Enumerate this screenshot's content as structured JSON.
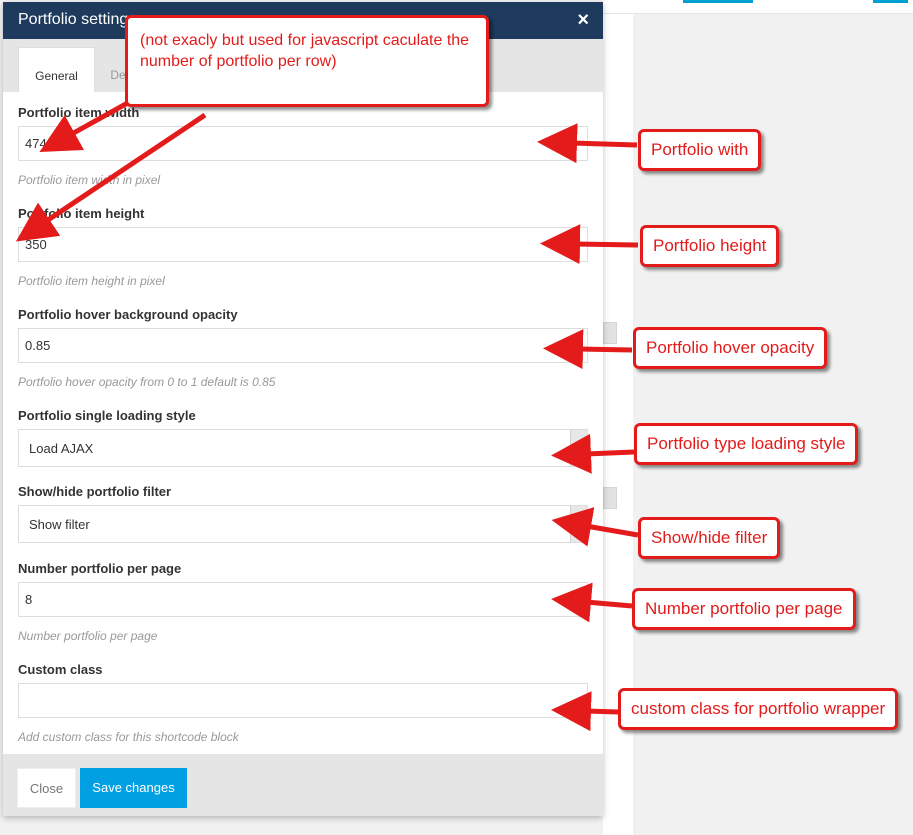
{
  "modal": {
    "title": "Portfolio settings",
    "close_icon": "×",
    "tabs": [
      {
        "label": "General"
      },
      {
        "label": "Design"
      }
    ]
  },
  "fields": {
    "item_width": {
      "label": "Portfolio item width",
      "value": "474",
      "help": "Portfolio item width in pixel"
    },
    "item_height": {
      "label": "Portfolio item height",
      "value": "350",
      "help": "Portfolio item height in pixel"
    },
    "hover_opacity": {
      "label": "Portfolio hover background opacity",
      "value": "0.85",
      "help": "Portfolio hover opacity from 0 to 1 default is 0.85"
    },
    "loading_style": {
      "label": "Portfolio single loading style",
      "value": "Load AJAX"
    },
    "show_filter": {
      "label": "Show/hide portfolio filter",
      "value": "Show filter"
    },
    "per_page": {
      "label": "Number portfolio per page",
      "value": "8",
      "help": "Number portfolio per page"
    },
    "custom_class": {
      "label": "Custom class",
      "value": "",
      "help": "Add custom class for this shortcode block"
    }
  },
  "footer": {
    "close_label": "Close",
    "save_label": "Save changes"
  },
  "annotations": {
    "note": "(not exacly but used for javascript caculate the number of portfolio per row)",
    "width": "Portfolio with",
    "height": "Portfolio height",
    "hover": "Portfolio hover opacity",
    "loading": "Portfolio type loading style",
    "filter": "Show/hide filter",
    "per_page": "Number portfolio per page",
    "custom": "custom class for portfolio wrapper"
  },
  "colors": {
    "header_bg": "#1e3a5c",
    "save_button": "#00a0e3",
    "annotation_red": "#e31b1b"
  }
}
